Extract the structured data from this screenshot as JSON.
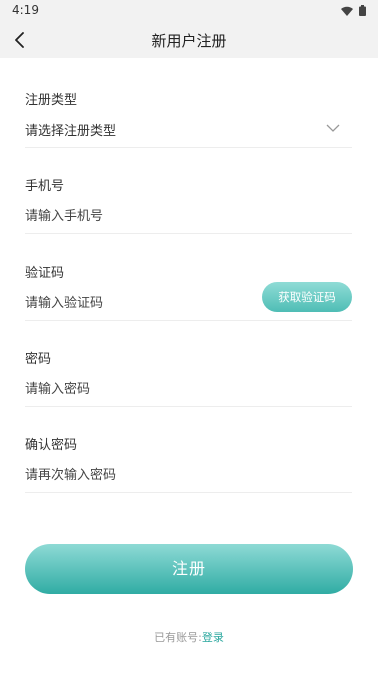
{
  "status_bar": {
    "time": "4:19"
  },
  "nav": {
    "title": "新用户注册"
  },
  "form": {
    "register_type": {
      "label": "注册类型",
      "value": "请选择注册类型"
    },
    "phone": {
      "label": "手机号",
      "placeholder": "请输入手机号"
    },
    "code": {
      "label": "验证码",
      "placeholder": "请输入验证码",
      "button": "获取验证码"
    },
    "password": {
      "label": "密码",
      "placeholder": "请输入密码"
    },
    "confirm": {
      "label": "确认密码",
      "placeholder": "请再次输入密码"
    }
  },
  "actions": {
    "register": "注册"
  },
  "footer": {
    "prompt": "已有账号",
    "separator": ":",
    "login": "登录"
  },
  "colors": {
    "accent": "#2aa79e",
    "button_top": "#8edad5",
    "button_bottom": "#30aca4"
  }
}
